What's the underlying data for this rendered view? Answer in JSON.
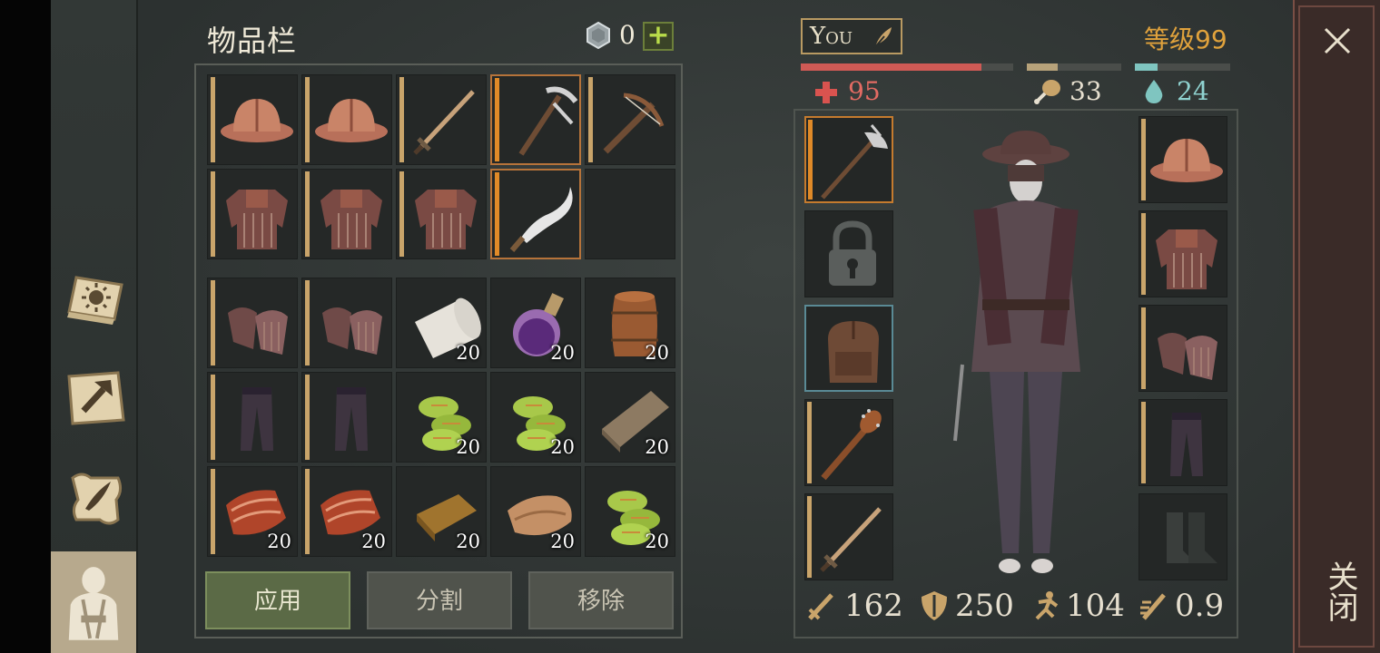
{
  "inventory": {
    "title": "物品栏",
    "coins": "0",
    "add_symbol": "+",
    "rows": [
      [
        {
          "icon": "kettle-helmet-icon"
        },
        {
          "icon": "kettle-helmet-icon"
        },
        {
          "icon": "longsword-icon"
        },
        {
          "icon": "pickaxe-icon",
          "selected": true
        },
        {
          "icon": "crossbow-icon"
        }
      ],
      [
        {
          "icon": "chainmail-shirt-icon"
        },
        {
          "icon": "chainmail-shirt-icon"
        },
        {
          "icon": "chainmail-shirt-icon"
        },
        {
          "icon": "curved-dagger-icon",
          "selected": true
        },
        {
          "icon": "empty"
        }
      ],
      [
        {
          "icon": "chainmail-gloves-icon"
        },
        {
          "icon": "chainmail-gloves-icon"
        },
        {
          "icon": "cloth-roll-icon",
          "qty": "20"
        },
        {
          "icon": "purple-potion-icon",
          "qty": "20"
        },
        {
          "icon": "barrel-icon",
          "qty": "20"
        }
      ],
      [
        {
          "icon": "chainmail-leggings-icon"
        },
        {
          "icon": "chainmail-leggings-icon"
        },
        {
          "icon": "green-coins-icon",
          "qty": "20"
        },
        {
          "icon": "green-coins-icon",
          "qty": "20"
        },
        {
          "icon": "wood-plank-icon",
          "qty": "20"
        }
      ],
      [
        {
          "icon": "raw-meat-icon",
          "qty": "20"
        },
        {
          "icon": "raw-meat-icon",
          "qty": "20"
        },
        {
          "icon": "bronze-ingot-icon",
          "qty": "20"
        },
        {
          "icon": "leather-icon",
          "qty": "20"
        },
        {
          "icon": "green-coins-icon",
          "qty": "20"
        }
      ]
    ],
    "buttons": {
      "apply": "应用",
      "split": "分割",
      "remove": "移除"
    }
  },
  "character": {
    "name": "You",
    "level": "等级99",
    "health": {
      "value": "95",
      "fraction": 0.85
    },
    "food": {
      "value": "33",
      "fraction": 0.33
    },
    "water": {
      "value": "24",
      "fraction": 0.24
    },
    "left_slots": [
      "halberd-icon",
      "lock-icon",
      "backpack-icon",
      "spiked-club-icon",
      "longsword-icon"
    ],
    "right_slots": [
      "kettle-helmet-icon",
      "chainmail-shirt-icon",
      "chainmail-gloves-icon",
      "chainmail-leggings-icon",
      "boots-placeholder-icon"
    ],
    "stats": {
      "attack": "162",
      "defense": "250",
      "speed": "104",
      "attack_speed": "0.9"
    }
  },
  "sidebar": {
    "items": [
      "map-sun-icon",
      "craft-hammer-icon",
      "quest-scroll-icon",
      "character-icon"
    ]
  },
  "close": {
    "label": "关闭"
  },
  "colors": {
    "accent_orange": "#e08a28",
    "health": "#cf5a55",
    "water": "#7fc5c0",
    "level": "#e0a23c"
  }
}
